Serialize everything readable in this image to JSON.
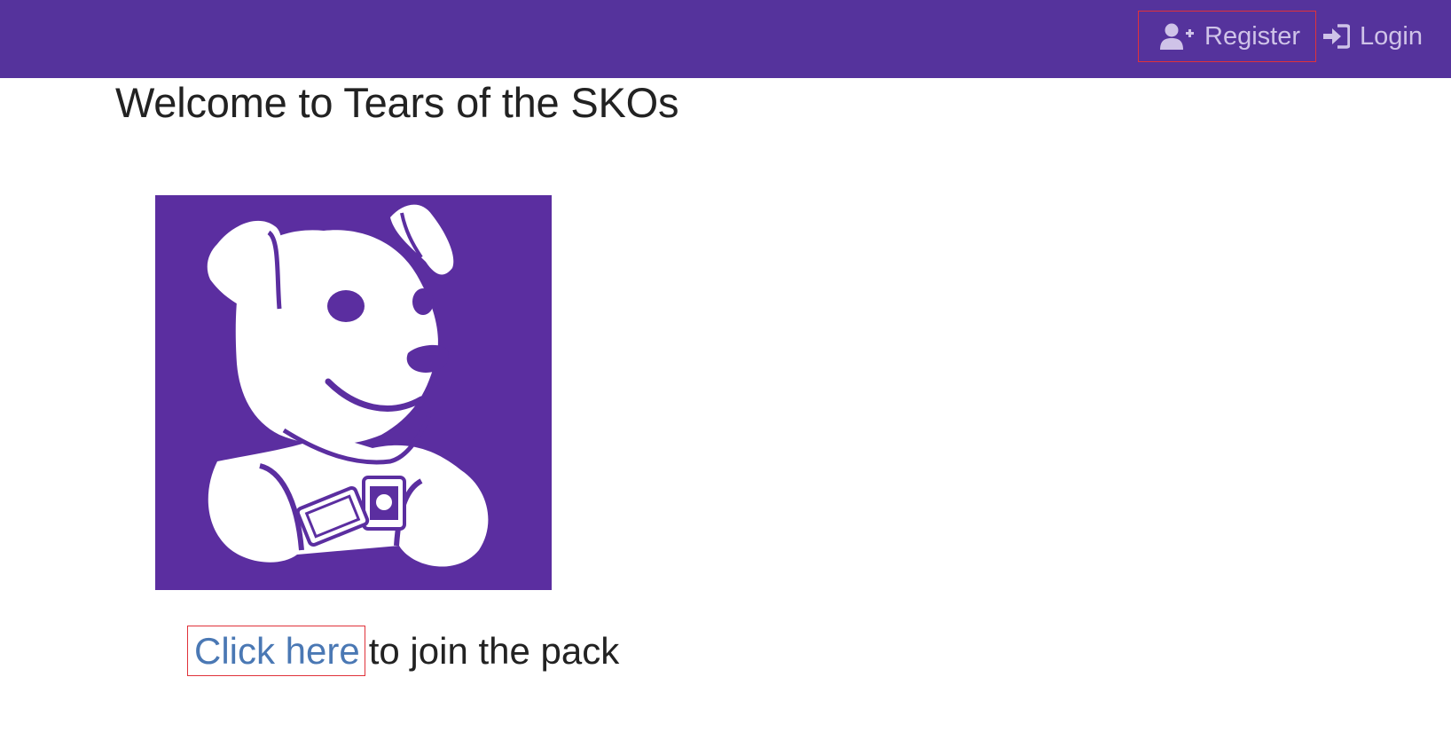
{
  "theme": {
    "navbar_color": "#55339c",
    "nav_text_color": "#cfc3e8",
    "link_color": "#4a78b4",
    "highlight_border": "#e0323a",
    "mascot_background": "#5b2ea0"
  },
  "navbar": {
    "register": {
      "label": "Register",
      "icon": "user-plus-icon"
    },
    "login": {
      "label": "Login",
      "icon": "sign-in-icon"
    }
  },
  "main": {
    "title": "Welcome to Tears of the SKOs",
    "mascot": {
      "icon": "dog-mascot-logo"
    },
    "cta": {
      "link_label": "Click here",
      "text": "to join the pack"
    }
  }
}
